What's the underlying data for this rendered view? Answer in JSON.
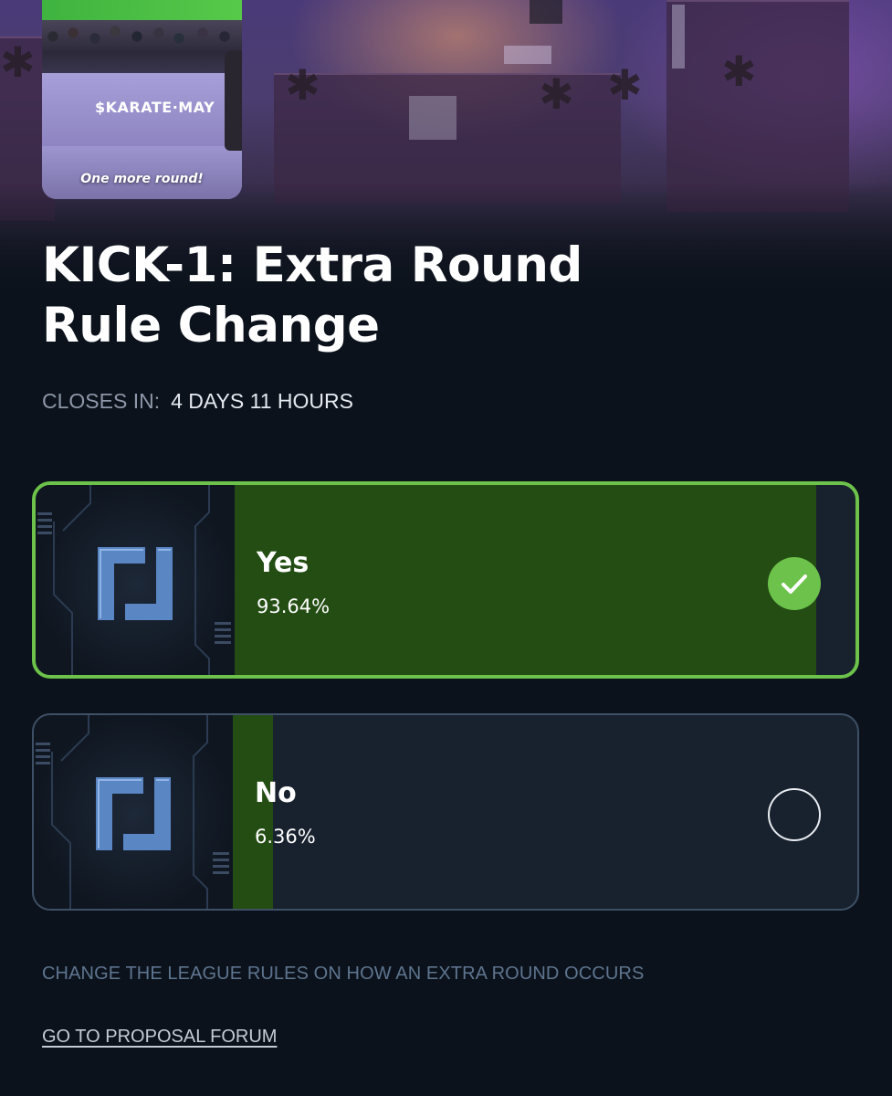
{
  "thumbnail": {
    "stage_text": "$KARATE·MAY",
    "caption": "One more round!"
  },
  "proposal": {
    "title": "KICK-1: Extra Round Rule Change",
    "closes_label": "CLOSES IN:",
    "closes_value": "4 DAYS 11 HOURS",
    "description": "CHANGE THE LEAGUE RULES ON HOW AN EXTRA ROUND OCCURS",
    "forum_link": "GO TO PROPOSAL FORUM"
  },
  "options": [
    {
      "label": "Yes",
      "percent_text": "93.64%",
      "percent": 93.64,
      "selected": true,
      "icon": "checkmark-icon"
    },
    {
      "label": "No",
      "percent_text": "6.36%",
      "percent": 6.36,
      "selected": false,
      "icon": "empty-radio-icon"
    }
  ],
  "colors": {
    "background": "#0b121b",
    "accent_green": "#6cc24a",
    "fill_green": "#234d13",
    "option_bg": "#18212e",
    "muted_text": "#8d97a8",
    "description_text": "#5e7590"
  }
}
